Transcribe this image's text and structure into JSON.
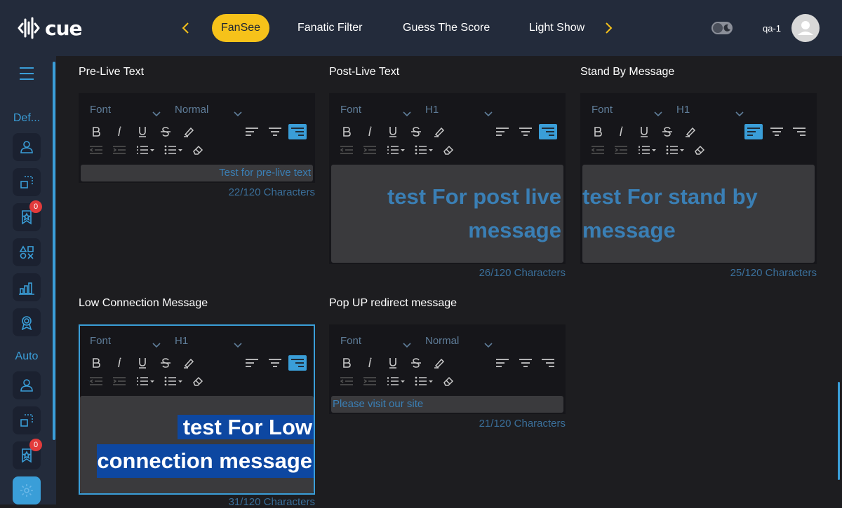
{
  "header": {
    "logo_text": "cue",
    "tabs": [
      {
        "label": "FanSee",
        "active": true
      },
      {
        "label": "Fanatic Filter",
        "active": false
      },
      {
        "label": "Guess The Score",
        "active": false
      },
      {
        "label": "Light Show",
        "active": false
      }
    ],
    "username": "qa-1"
  },
  "sidebar": {
    "section1_label": "Def...",
    "section2_label": "Auto",
    "badge1": "0",
    "badge2": "0",
    "icons": [
      "user-icon",
      "crop-icon",
      "badge-star-icon",
      "shapes-icon",
      "bar-chart-icon",
      "award-icon",
      "user-icon",
      "crop-icon",
      "badge-star-icon",
      "settings-icon"
    ]
  },
  "sections": [
    {
      "title": "Pre-Live Text",
      "font_label": "Font",
      "size_label": "Normal",
      "content": "Test for pre-live text",
      "count": "22/120 Characters"
    },
    {
      "title": "Post-Live Text",
      "font_label": "Font",
      "size_label": "H1",
      "content": "test For post live message",
      "count": "26/120 Characters"
    },
    {
      "title": "Stand By Message",
      "font_label": "Font",
      "size_label": "H1",
      "content": "test For stand by message",
      "count": "25/120 Characters"
    },
    {
      "title": "Low Connection Message",
      "font_label": "Font",
      "size_label": "H1",
      "content_line1": "test For Low",
      "content_line2": "connection message",
      "count": "31/120 Characters"
    },
    {
      "title": "Pop UP redirect message",
      "font_label": "Font",
      "size_label": "Normal",
      "content": "Please visit our site",
      "count": "21/120 Characters"
    }
  ],
  "colors": {
    "accent": "#3a9ed8",
    "brand_yellow": "#f6c21a",
    "header_bg": "#232b3b",
    "selection": "#0d47a1"
  }
}
